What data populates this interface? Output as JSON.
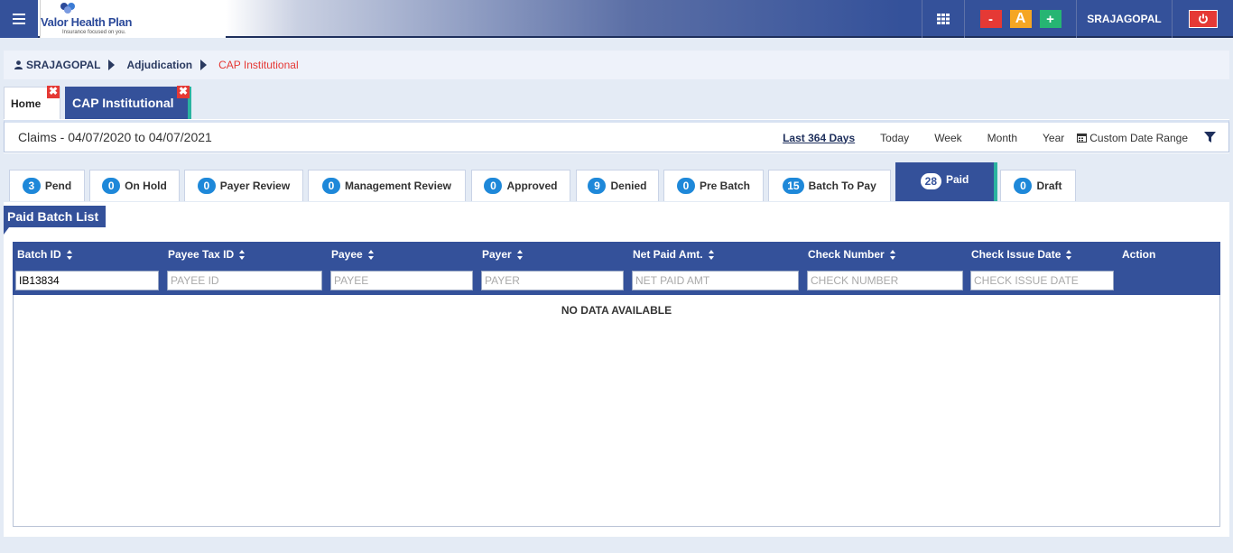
{
  "header": {
    "logo_name": "Valor Health Plan",
    "logo_tagline": "Insurance focused on you.",
    "font_minus": "-",
    "font_a": "A",
    "font_plus": "+",
    "username": "SRAJAGOPAL"
  },
  "breadcrumb": {
    "user": "SRAJAGOPAL",
    "section": "Adjudication",
    "current": "CAP Institutional"
  },
  "page_tabs": {
    "home": "Home",
    "cap": "CAP Institutional",
    "close_glyph": "✖"
  },
  "claims_bar": {
    "title": "Claims - 04/07/2020 to 04/07/2021",
    "ranges": [
      "Last 364 Days",
      "Today",
      "Week",
      "Month",
      "Year"
    ],
    "custom": "Custom Date Range"
  },
  "status_tabs": [
    {
      "count": "3",
      "label": "Pend"
    },
    {
      "count": "0",
      "label": "On Hold"
    },
    {
      "count": "0",
      "label": "Payer Review"
    },
    {
      "count": "0",
      "label": "Management Review"
    },
    {
      "count": "0",
      "label": "Approved"
    },
    {
      "count": "9",
      "label": "Denied"
    },
    {
      "count": "0",
      "label": "Pre Batch"
    },
    {
      "count": "15",
      "label": "Batch To Pay"
    },
    {
      "count": "28",
      "label": "Paid"
    },
    {
      "count": "0",
      "label": "Draft"
    }
  ],
  "list": {
    "title": "Paid Batch List",
    "columns": [
      "Batch ID",
      "Payee Tax ID",
      "Payee",
      "Payer",
      "Net Paid Amt.",
      "Check Number",
      "Check Issue Date",
      "Action"
    ],
    "filters": {
      "batch_id_value": "IB13834",
      "payee_tax_id_placeholder": "PAYEE ID",
      "payee_placeholder": "PAYEE",
      "payer_placeholder": "PAYER",
      "net_paid_placeholder": "NET PAID AMT",
      "check_number_placeholder": "CHECK NUMBER",
      "check_issue_date_placeholder": "CHECK ISSUE DATE"
    },
    "empty_message": "NO DATA AVAILABLE"
  },
  "colors": {
    "primary": "#34519a",
    "accent_teal": "#2bb3a0",
    "badge_blue": "#1e88d9",
    "danger": "#e53935",
    "warning": "#f5a623",
    "success": "#26b573"
  },
  "icons": [
    "menu-icon",
    "apps-grid-icon",
    "power-icon",
    "user-icon",
    "calendar-icon",
    "filter-icon",
    "sort-icon",
    "close-icon"
  ]
}
